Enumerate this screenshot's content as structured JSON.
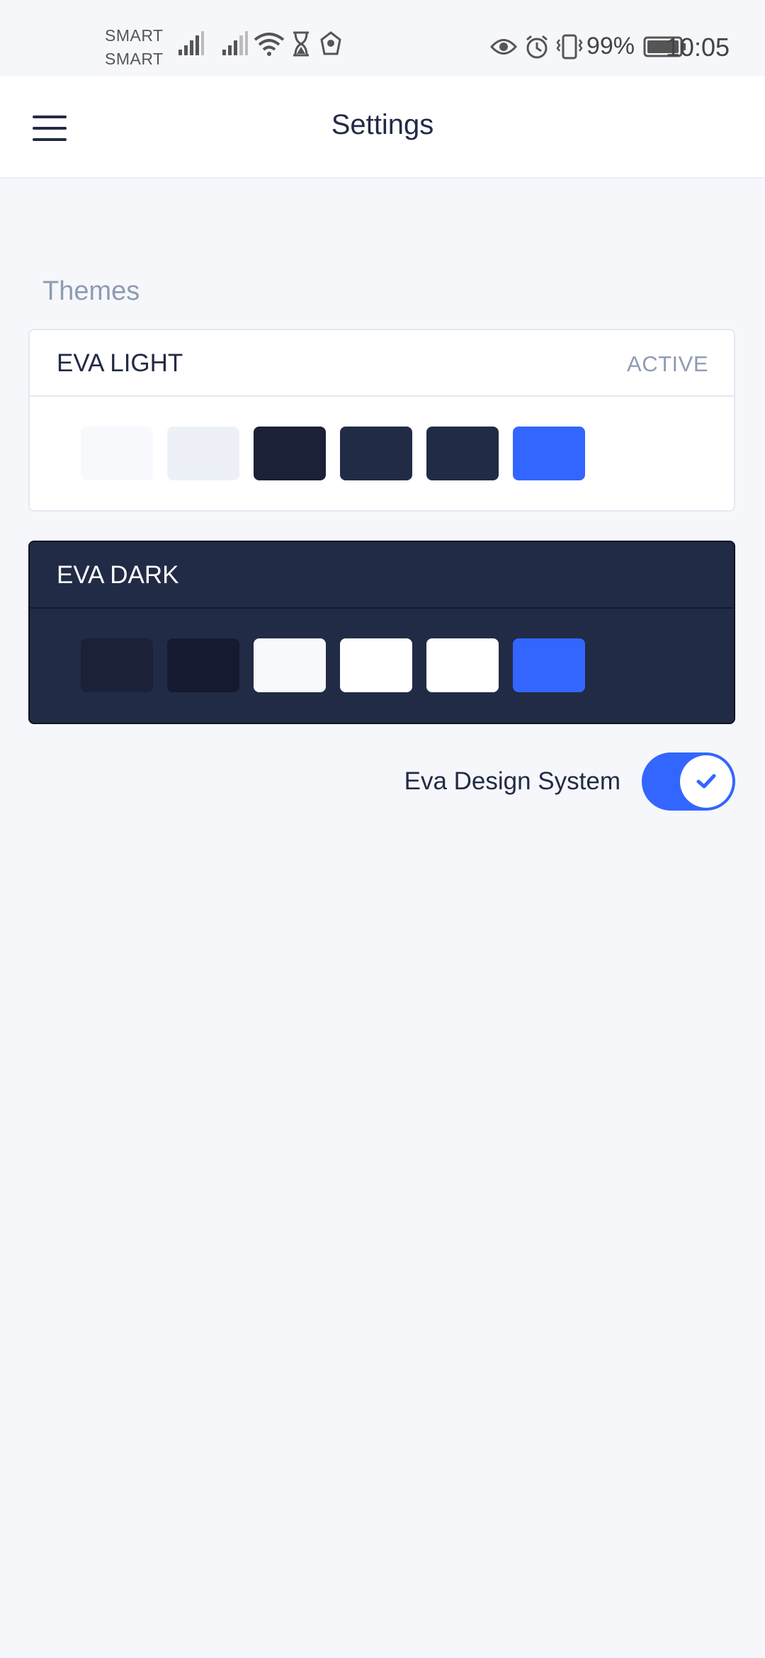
{
  "status_bar": {
    "carrier_1": "SMART",
    "carrier_2": "SMART",
    "battery": "99%",
    "time": "10:05",
    "icons": [
      "signal-icon",
      "signal-icon",
      "wifi-icon",
      "hourglass-icon",
      "app-icon",
      "eye-icon",
      "alarm-icon",
      "vibrate-icon",
      "battery-icon"
    ]
  },
  "header": {
    "title": "Settings",
    "menu_icon": "menu-icon"
  },
  "themes_section": {
    "title": "Themes",
    "cards": [
      {
        "name": "EVA LIGHT",
        "status": "ACTIVE",
        "swatches": [
          "#f7f9fc",
          "#edf1f7",
          "#1a2138",
          "#222b45",
          "#222b45",
          "#3366ff"
        ]
      },
      {
        "name": "EVA DARK",
        "status": "",
        "swatches": [
          "#1a2138",
          "#151a30",
          "#f7f9fc",
          "#ffffff",
          "#ffffff",
          "#3366ff"
        ]
      }
    ]
  },
  "design_system_toggle": {
    "label": "Eva Design System",
    "checked": true
  },
  "colors": {
    "accent": "#3366ff",
    "text": "#222b45",
    "hint": "#8f9bb3",
    "background": "#f6f7fb"
  }
}
